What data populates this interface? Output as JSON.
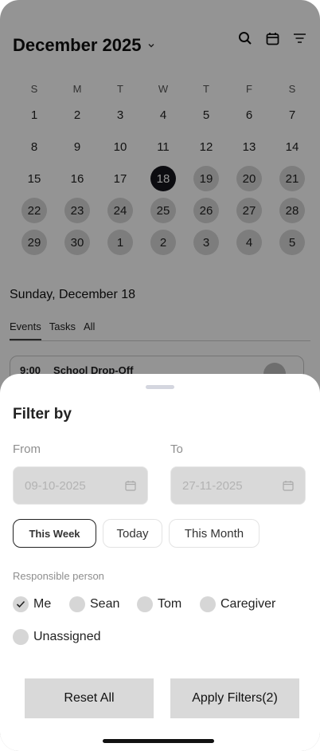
{
  "calendar": {
    "month_title": "December 2025",
    "weekdays": [
      "S",
      "M",
      "T",
      "W",
      "T",
      "F",
      "S"
    ],
    "days": [
      {
        "d": "1",
        "busy": false
      },
      {
        "d": "2",
        "busy": false
      },
      {
        "d": "3",
        "busy": false
      },
      {
        "d": "4",
        "busy": false
      },
      {
        "d": "5",
        "busy": false
      },
      {
        "d": "6",
        "busy": false
      },
      {
        "d": "7",
        "busy": false
      },
      {
        "d": "8",
        "busy": false
      },
      {
        "d": "9",
        "busy": false
      },
      {
        "d": "10",
        "busy": false
      },
      {
        "d": "11",
        "busy": false
      },
      {
        "d": "12",
        "busy": false
      },
      {
        "d": "13",
        "busy": false
      },
      {
        "d": "14",
        "busy": false
      },
      {
        "d": "15",
        "busy": false
      },
      {
        "d": "16",
        "busy": false
      },
      {
        "d": "17",
        "busy": false
      },
      {
        "d": "18",
        "busy": false,
        "selected": true
      },
      {
        "d": "19",
        "busy": true
      },
      {
        "d": "20",
        "busy": true
      },
      {
        "d": "21",
        "busy": true
      },
      {
        "d": "22",
        "busy": true
      },
      {
        "d": "23",
        "busy": true
      },
      {
        "d": "24",
        "busy": true
      },
      {
        "d": "25",
        "busy": true
      },
      {
        "d": "26",
        "busy": true
      },
      {
        "d": "27",
        "busy": true
      },
      {
        "d": "28",
        "busy": true
      },
      {
        "d": "29",
        "busy": true
      },
      {
        "d": "30",
        "busy": true
      },
      {
        "d": "1",
        "busy": true
      },
      {
        "d": "2",
        "busy": true
      },
      {
        "d": "3",
        "busy": true
      },
      {
        "d": "4",
        "busy": true
      },
      {
        "d": "5",
        "busy": true
      }
    ],
    "selected_date_label": "Sunday, December 18",
    "tabs": [
      "Events",
      "Tasks",
      "All"
    ],
    "event": {
      "time": "9:00",
      "title": "School Drop-Off"
    }
  },
  "filter": {
    "title": "Filter by",
    "from_label": "From",
    "to_label": "To",
    "from_value": "09-10-2025",
    "to_value": "27-11-2025",
    "chips": [
      "This Week",
      "Today",
      "This Month"
    ],
    "responsible_label": "Responsible person",
    "people": [
      {
        "name": "Me",
        "checked": true
      },
      {
        "name": "Sean",
        "checked": false
      },
      {
        "name": "Tom",
        "checked": false
      },
      {
        "name": "Caregiver",
        "checked": false
      },
      {
        "name": "Unassigned",
        "checked": false
      }
    ],
    "reset_label": "Reset All",
    "apply_label": "Apply Filters(2)"
  }
}
